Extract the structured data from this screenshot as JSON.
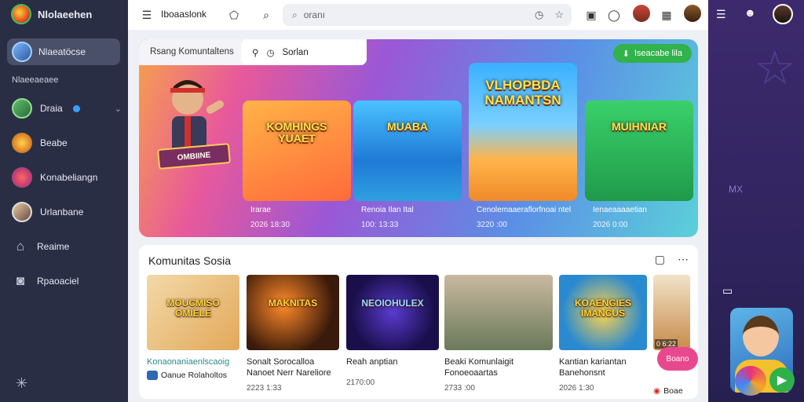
{
  "app": {
    "name": "Nlolaeehen"
  },
  "sidebar": {
    "profile_name": "Nlaeatöcse",
    "section_label": "Nlaeeaeaee",
    "items": [
      {
        "label": "Draia",
        "icon": "user-avatar-icon",
        "verified": true
      },
      {
        "label": "Beabe",
        "icon": "game-icon"
      },
      {
        "label": "Konabeliangn",
        "icon": "game-icon"
      },
      {
        "label": "Urlanbane",
        "icon": "user-avatar-icon"
      },
      {
        "label": "Reaime",
        "icon": "home-icon"
      },
      {
        "label": "Rpaoaciel",
        "icon": "camera-icon"
      }
    ]
  },
  "topbar": {
    "title": "Iboaaslonk",
    "search_placeholder": "oranı"
  },
  "hero": {
    "tab1": "Rsang Komuntaltens",
    "tab2": "Sorlan",
    "badge": "Iseacabe lila",
    "sign": "OMBIINE",
    "feature_title": "VLHOPBDA NAMANTSN",
    "cards": [
      {
        "art_title": "KOMHINGS YUAET",
        "title": "Irarae",
        "meta": "2026 18:30"
      },
      {
        "art_title": "MUABA",
        "title": "Renoia Ilan Ital",
        "meta": "100: 13:33"
      },
      {
        "art_title": "",
        "title": "Cenolemaaeraflorfnoai ntel",
        "meta": "3220 :00"
      },
      {
        "art_title": "MUIHNIAR",
        "title": "Ienaeaaaaetian",
        "meta": "2026 0:00"
      }
    ]
  },
  "community": {
    "title": "Komunitas Sosia",
    "cards": [
      {
        "art_title": "MOUCMISO OMIELE",
        "title": "Konaonaniaenlscaoig",
        "channel": "Oanue Rolaholtos",
        "meta": ""
      },
      {
        "art_title": "MAKNITAS",
        "title": "Sonalt Sorocalloa Nanoet Nerr Nareliore",
        "channel": "",
        "meta": "2223 1:33"
      },
      {
        "art_title": "NEOIOHULEX",
        "title": "Reah anptian",
        "channel": "",
        "meta": "2170:00"
      },
      {
        "art_title": "",
        "title": "Beaki Komunlaigit Fonoeoaartas",
        "channel": "",
        "meta": "2733 :00"
      },
      {
        "art_title": "KOAENGIES IMANCUS",
        "title": "Kantian kariantan Banehonsnt",
        "channel": "",
        "meta": "2026 1:30"
      },
      {
        "art_title": "",
        "title": "",
        "channel": "Boae",
        "meta": "0 6:22"
      }
    ],
    "play_label": "Boano"
  },
  "right": {
    "panel_label": "MX"
  }
}
